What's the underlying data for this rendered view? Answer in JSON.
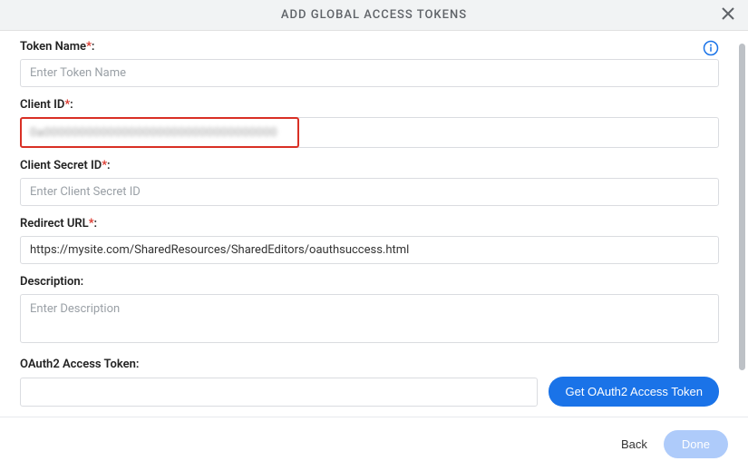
{
  "header": {
    "title": "ADD GLOBAL ACCESS TOKENS"
  },
  "form": {
    "tokenName": {
      "label": "Token Name",
      "required": "*",
      "colon": ":",
      "placeholder": "Enter Token Name",
      "value": ""
    },
    "clientId": {
      "label": "Client ID",
      "required": "*",
      "colon": ":",
      "value": "0a000000000000000000000000000000000"
    },
    "clientSecret": {
      "label": "Client Secret ID",
      "required": "*",
      "colon": ":",
      "placeholder": "Enter Client Secret ID",
      "value": ""
    },
    "redirectUrl": {
      "label": "Redirect URL",
      "required": "*",
      "colon": ":",
      "value": "https://mysite.com/SharedResources/SharedEditors/oauthsuccess.html"
    },
    "description": {
      "label": "Description:",
      "placeholder": "Enter Description",
      "value": ""
    },
    "oauthToken": {
      "label": "OAuth2 Access Token:",
      "value": "",
      "buttonLabel": "Get OAuth2 Access Token"
    }
  },
  "footer": {
    "back": "Back",
    "done": "Done"
  }
}
